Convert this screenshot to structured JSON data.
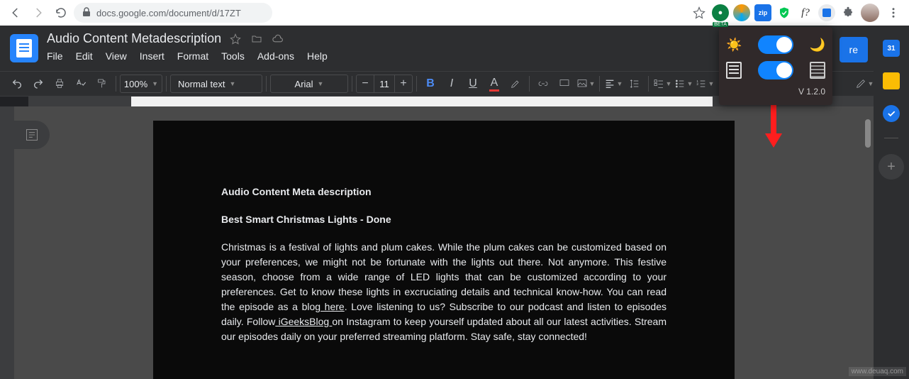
{
  "browser": {
    "url": "docs.google.com/document/d/17ZT"
  },
  "doc": {
    "title": "Audio Content Metadescription"
  },
  "menus": {
    "file": "File",
    "edit": "Edit",
    "view": "View",
    "insert": "Insert",
    "format": "Format",
    "tools": "Tools",
    "addons": "Add-ons",
    "help": "Help"
  },
  "toolbar": {
    "zoom": "100%",
    "style": "Normal text",
    "font": "Arial",
    "font_size": "11"
  },
  "share": {
    "label": "re"
  },
  "extension": {
    "version": "V 1.2.0"
  },
  "content": {
    "heading1": "Audio Content Meta description",
    "heading2": "Best Smart Christmas Lights - Done",
    "p_part1": "Christmas is a festival of lights and plum cakes. While the plum cakes can be customized based on your preferences, we might not be fortunate with the lights out there. Not anymore. This festive season, choose from a wide range of LED lights that can be customized according to your preferences. Get to know these lights in excruciating details and technical know-how. You can read the episode as a blog",
    "link1": " here",
    "p_part2": ". Love listening to us? Subscribe to our podcast and listen to episodes daily. Follow",
    "link2": " iGeeksBlog ",
    "p_part3": "on Instagram to keep yourself updated about all our latest activities. Stream our episodes daily on your preferred streaming platform. Stay safe, stay connected!"
  },
  "watermark": "www.deuaq.com"
}
